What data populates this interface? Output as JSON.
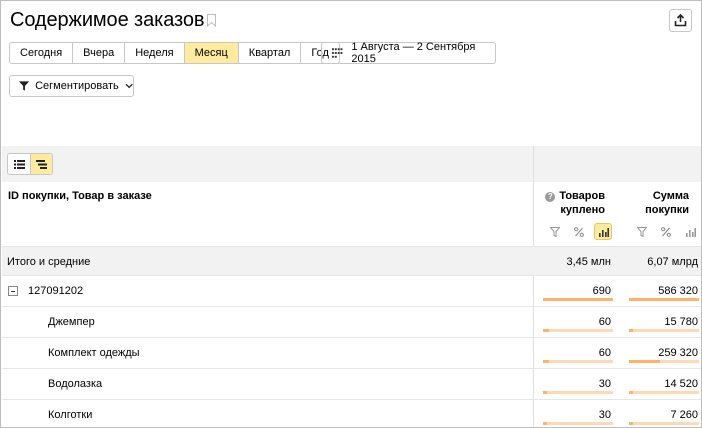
{
  "header": {
    "title": "Содержимое заказов"
  },
  "periods": [
    {
      "label": "Сегодня",
      "active": false
    },
    {
      "label": "Вчера",
      "active": false
    },
    {
      "label": "Неделя",
      "active": false
    },
    {
      "label": "Месяц",
      "active": true
    },
    {
      "label": "Квартал",
      "active": false
    },
    {
      "label": "Год",
      "active": false
    }
  ],
  "date_range": "1 Августа — 2 Сентября 2015",
  "segment_label": "Сегментировать",
  "table": {
    "dimension_header": "ID покупки, Товар в заказе",
    "metrics": [
      {
        "line1": "Товаров",
        "line2": "куплено"
      },
      {
        "line1": "Сумма",
        "line2": "покупки"
      }
    ],
    "totals": {
      "label": "Итого и средние",
      "values": [
        "3,45 млн",
        "6,07 млрд"
      ]
    },
    "rows": [
      {
        "label": "127091202",
        "values": [
          "690",
          "586 320"
        ],
        "shares": [
          1.0,
          1.0
        ]
      },
      {
        "label": "Джемпер",
        "values": [
          "60",
          "15 780"
        ],
        "shares": [
          0.087,
          0.027
        ]
      },
      {
        "label": "Комплект одежды",
        "values": [
          "60",
          "259 320"
        ],
        "shares": [
          0.087,
          0.442
        ]
      },
      {
        "label": "Водолазка",
        "values": [
          "30",
          "14 520"
        ],
        "shares": [
          0.043,
          0.025
        ]
      },
      {
        "label": "Колготки",
        "values": [
          "30",
          "7 260"
        ],
        "shares": [
          0.043,
          0.012
        ]
      }
    ]
  },
  "colors": {
    "active_bg": "#ffeba0",
    "bar_fill": "#ffb26b",
    "bar_track": "#ffd9b3"
  }
}
